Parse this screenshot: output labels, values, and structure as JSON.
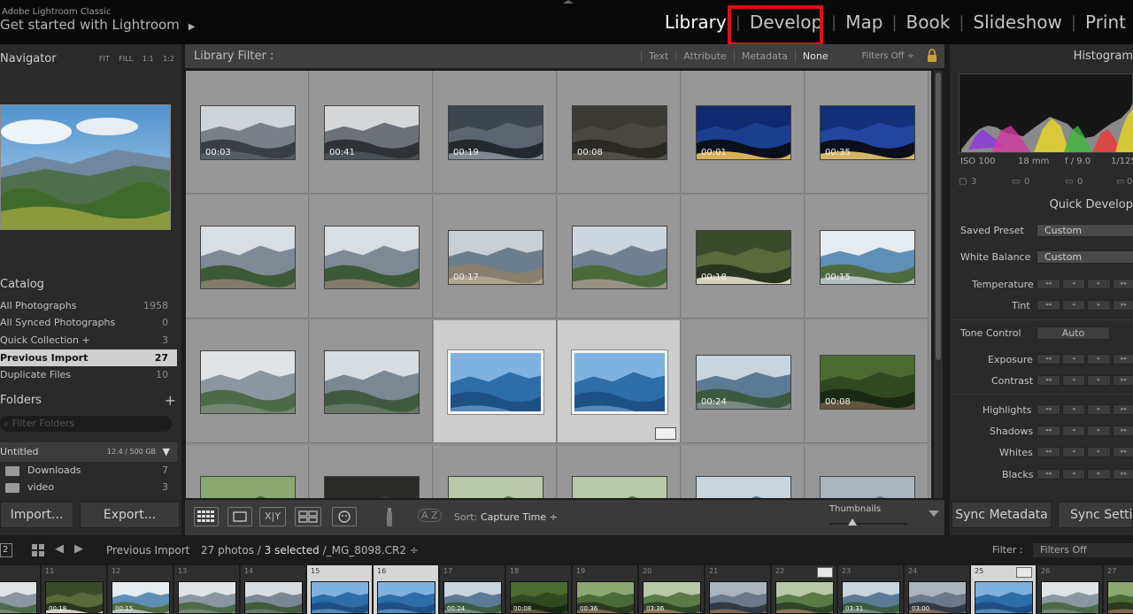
{
  "app": {
    "subtitle": "Adobe Lightroom Classic",
    "title": "Get started with Lightroom"
  },
  "modules": [
    "Library",
    "Develop",
    "Map",
    "Book",
    "Slideshow",
    "Print"
  ],
  "active_module": "Library",
  "left": {
    "navigator": {
      "label": "Navigator",
      "options": "FIT FILL 1:1 1:2"
    },
    "catalog": {
      "label": "Catalog",
      "items": [
        {
          "label": "All Photographs",
          "count": "1958"
        },
        {
          "label": "All Synced Photographs",
          "count": "0"
        },
        {
          "label": "Quick Collection +",
          "count": "3"
        },
        {
          "label": "Previous Import",
          "count": "27"
        },
        {
          "label": "Duplicate Files",
          "count": "10"
        }
      ]
    },
    "folders": {
      "label": "Folders",
      "plus": "+",
      "filter_placeholder": "Filter Folders",
      "volume": {
        "name": "Untitled",
        "size": "12.4 / 500 GB"
      },
      "items": [
        {
          "label": "Downloads",
          "count": "7"
        },
        {
          "label": "video",
          "count": "3"
        }
      ]
    },
    "import_label": "Import...",
    "export_label": "Export..."
  },
  "filter_bar": {
    "label": "Library Filter :",
    "options": [
      "Text",
      "Attribute",
      "Metadata",
      "None"
    ],
    "filters_off": "Filters Off ÷"
  },
  "grid": {
    "cells": [
      {
        "dur": "00:03",
        "scene": "stormy"
      },
      {
        "dur": "00:41",
        "scene": "stormy2"
      },
      {
        "dur": "00:19",
        "scene": "aerial"
      },
      {
        "dur": "00:08",
        "scene": "ground"
      },
      {
        "dur": "00:01",
        "scene": "city"
      },
      {
        "dur": "00:35",
        "scene": "city2"
      },
      {
        "dur": "",
        "scene": "overlook"
      },
      {
        "dur": "",
        "scene": "overlook"
      },
      {
        "dur": "00:17",
        "scene": "tilt"
      },
      {
        "dur": "",
        "scene": "overlook2"
      },
      {
        "dur": "00:18",
        "scene": "rock"
      },
      {
        "dur": "00:15",
        "scene": "tilt2"
      },
      {
        "dur": "",
        "scene": "valley"
      },
      {
        "dur": "",
        "scene": "valley2"
      },
      {
        "dur": "",
        "scene": "blue",
        "selected": true
      },
      {
        "dur": "",
        "scene": "blue",
        "selected": true
      },
      {
        "dur": "00:24",
        "scene": "valley3"
      },
      {
        "dur": "00:08",
        "scene": "face"
      },
      {
        "dur": "",
        "scene": "face2"
      },
      {
        "dur": "",
        "scene": "dark"
      },
      {
        "dur": "",
        "scene": "face3"
      },
      {
        "dur": "",
        "scene": "face3"
      },
      {
        "dur": "",
        "scene": "valley3"
      },
      {
        "dur": "",
        "scene": "face4"
      }
    ]
  },
  "toolbar": {
    "sort_label": "Sort:",
    "sort_value": "Capture Time ÷",
    "thumbnails_label": "Thumbnails",
    "thumbnail_size": 0.3,
    "az": "A Z"
  },
  "right": {
    "histogram_label": "Histogram",
    "info": {
      "iso": "ISO 100",
      "focal": "18 mm",
      "aperture": "f / 9.0",
      "shutter": "1/125"
    },
    "tools": {
      "crop": "3",
      "a": "0",
      "b": "0",
      "c": "0"
    },
    "quick_develop_label": "Quick Develop",
    "saved_preset_label": "Saved Preset",
    "saved_preset_value": "Custom",
    "white_balance_label": "White Balance",
    "white_balance_value": "Custom",
    "temperature_label": "Temperature",
    "tint_label": "Tint",
    "tone_control_label": "Tone Control",
    "auto_label": "Auto",
    "exposure_label": "Exposure",
    "contrast_label": "Contrast",
    "highlights_label": "Highlights",
    "shadows_label": "Shadows",
    "whites_label": "Whites",
    "blacks_label": "Blacks",
    "sync_metadata_label": "Sync Metadata",
    "sync_settings_label": "Sync Settings"
  },
  "filmstrip_bar": {
    "page": "2",
    "source": "Previous Import",
    "count_prefix": "27 photos /",
    "count_selected": "3 selected",
    "count_file": "/_MG_8098.CR2 ÷",
    "filter_label": "Filter :",
    "filter_value": "Filters Off"
  },
  "filmstrip": [
    {
      "num": "",
      "dur": "",
      "scene": "valley"
    },
    {
      "num": "11",
      "dur": "00:18",
      "scene": "rock"
    },
    {
      "num": "12",
      "dur": "00:15",
      "scene": "tilt2"
    },
    {
      "num": "13",
      "dur": "",
      "scene": "valley"
    },
    {
      "num": "14",
      "dur": "",
      "scene": "valley2"
    },
    {
      "num": "15",
      "dur": "",
      "scene": "blue",
      "selected": true
    },
    {
      "num": "16",
      "dur": "",
      "scene": "blue",
      "selected": true
    },
    {
      "num": "17",
      "dur": "00:24",
      "scene": "valley3"
    },
    {
      "num": "18",
      "dur": "00:08",
      "scene": "face"
    },
    {
      "num": "19",
      "dur": "00:36",
      "scene": "face2"
    },
    {
      "num": "20",
      "dur": "03:36",
      "scene": "face3"
    },
    {
      "num": "21",
      "dur": "",
      "scene": "face4"
    },
    {
      "num": "22",
      "dur": "",
      "scene": "face3"
    },
    {
      "num": "23",
      "dur": "03:31",
      "scene": "valley3"
    },
    {
      "num": "24",
      "dur": "03:00",
      "scene": "face4"
    },
    {
      "num": "25",
      "dur": "",
      "scene": "blue",
      "selected": true
    },
    {
      "num": "26",
      "dur": "",
      "scene": "valley"
    },
    {
      "num": "27",
      "dur": "",
      "scene": "face2"
    }
  ]
}
